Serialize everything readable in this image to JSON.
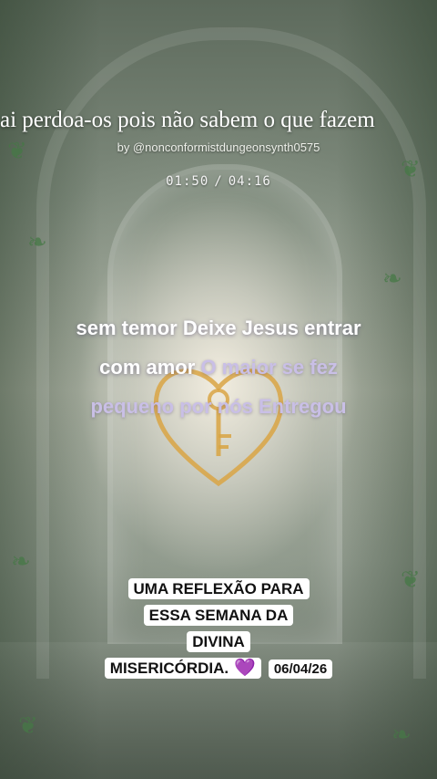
{
  "overlay": {
    "title": "ai  perdoa-os pois não sabem o que fazem",
    "byline": "by @nonconformistdungeonsynth0575",
    "time_current": "01:50",
    "time_separator": "/",
    "time_total": "04:16"
  },
  "lyrics": {
    "line1_sung": "sem temor Deixe Jesus entrar",
    "line2_sung": "com amor",
    "line2_pending": "O maior se fez",
    "line3_pending": "pequeno por nós Entregou"
  },
  "caption": {
    "line1": "UMA REFLEXÃO PARA",
    "line2": "ESSA SEMANA DA",
    "line3": "DIVINA",
    "line4": "MISERICÓRDIA.",
    "emoji": "💜",
    "date": "06/04/26"
  },
  "colors": {
    "lyric_sung": "#ffffff",
    "lyric_pending": "#c9bfe6",
    "heart_outline": "#d9a544",
    "caption_bg": "#ffffff"
  },
  "icons": {
    "background_heart": "heart-key-icon",
    "caption_emoji": "purple-heart-icon"
  }
}
